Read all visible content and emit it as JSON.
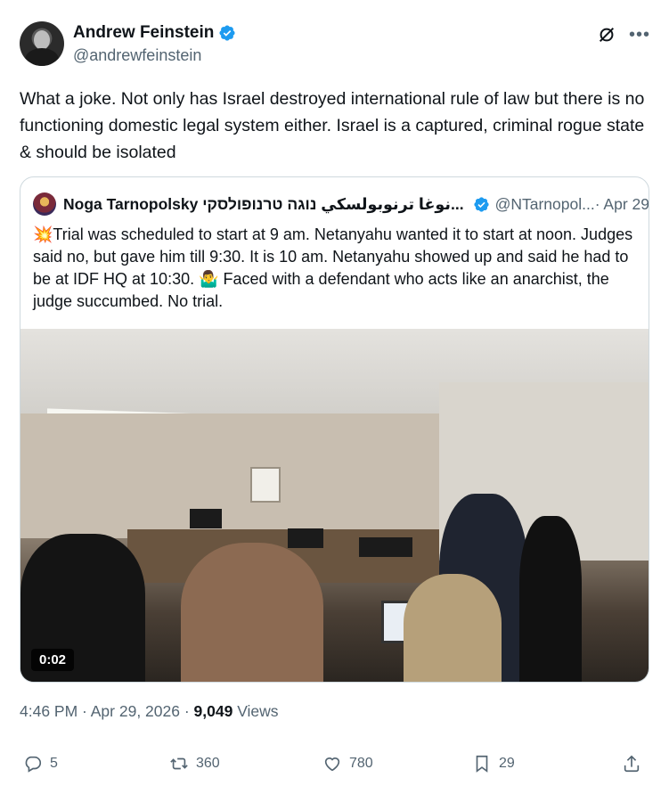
{
  "author": {
    "display_name": "Andrew Feinstein",
    "handle": "@andrewfeinstein"
  },
  "tweet": {
    "text": "What a joke. Not only has Israel destroyed international rule of law but there is no functioning domestic legal system either. Israel is a captured, criminal rogue state & should be isolated"
  },
  "quote": {
    "display_name": "Noga Tarnopolsky نوغا ترنوبولسكي נוגה טרנופולסקי...",
    "handle": "@NTarnopol...",
    "date": "· Apr 29",
    "text": "💥Trial was scheduled to start at 9 am. Netanyahu wanted it to start at noon. Judges said no, but gave him till 9:30. It is 10 am. Netanyahu showed up and said he had to be at IDF HQ at 10:30. 🤷‍♂️ Faced with a defendant who acts like an anarchist, the judge succumbed. No trial.",
    "video_timer": "0:02"
  },
  "meta": {
    "timestamp": "4:46 PM · Apr 29, 2026 · ",
    "views_count": "9,049",
    "views_label": " Views"
  },
  "actions": {
    "replies": "5",
    "reposts": "360",
    "likes": "780",
    "bookmarks": "29"
  },
  "colors": {
    "verified": "#1d9bf0",
    "secondary_text": "#536471",
    "primary_text": "#0f1419",
    "border": "#cfd9de"
  },
  "icons": {
    "verified": "verified-badge-icon",
    "grok": "grok-icon",
    "more": "more-icon",
    "reply": "reply-icon",
    "retweet": "retweet-icon",
    "like": "heart-icon",
    "bookmark": "bookmark-icon",
    "share": "share-icon"
  }
}
